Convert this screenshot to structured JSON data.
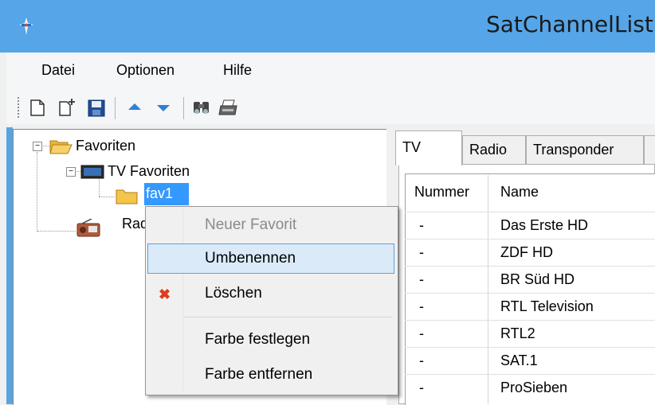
{
  "window": {
    "title": "SatChannelList"
  },
  "menu": [
    "Datei",
    "Optionen",
    "Hilfe"
  ],
  "toolbar": {
    "buttons": [
      "new-file-icon",
      "import-icon",
      "save-icon",
      "move-up-icon",
      "move-down-icon",
      "find-icon",
      "print-icon"
    ]
  },
  "tree": {
    "root": "Favoriten",
    "tv": "TV Favoriten",
    "fav1": "fav1",
    "radio": "Rad"
  },
  "tabs": [
    "TV",
    "Radio",
    "Transponder"
  ],
  "grid": {
    "columns": [
      "Nummer",
      "Name"
    ],
    "rows": [
      {
        "nummer": "-",
        "name": "Das Erste HD"
      },
      {
        "nummer": "-",
        "name": "ZDF HD"
      },
      {
        "nummer": "-",
        "name": "BR Süd HD"
      },
      {
        "nummer": "-",
        "name": "RTL Television"
      },
      {
        "nummer": "-",
        "name": "RTL2"
      },
      {
        "nummer": "-",
        "name": "SAT.1"
      },
      {
        "nummer": "-",
        "name": "ProSieben"
      }
    ]
  },
  "context_menu": {
    "items": [
      {
        "label": "Neuer Favorit",
        "state": "disabled"
      },
      {
        "label": "Umbenennen",
        "state": "hover"
      },
      {
        "label": "Löschen",
        "icon": "delete-x-icon"
      },
      {
        "label": "Farbe festlegen"
      },
      {
        "label": "Farbe entfernen"
      }
    ]
  },
  "colors": {
    "titlebar": "#55a5e8",
    "selection": "#3399ff",
    "menu_hover": "#dbeaf8",
    "delete_icon": "#e03c1e"
  }
}
